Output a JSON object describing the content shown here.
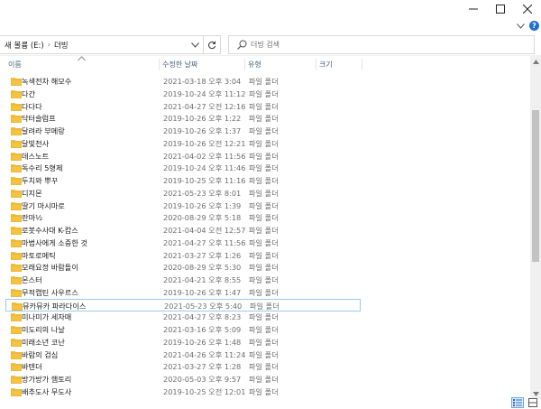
{
  "window": {
    "controls": [
      "minimize-icon",
      "maximize-icon",
      "close-icon"
    ]
  },
  "ribbon": {
    "help_label": "?"
  },
  "address": {
    "crumbs": [
      "새 볼륨 (E:)",
      "더빙"
    ],
    "separator": "›"
  },
  "search": {
    "placeholder": "더빙 검색"
  },
  "columns": {
    "name": "이름",
    "date": "수정한 날짜",
    "type": "유형",
    "size": "크기"
  },
  "colors": {
    "folder": "#f5c342",
    "selection_border": "#99c9ef",
    "accent": "#1f6fd1"
  },
  "files": [
    {
      "name": "녹색전차 해모수",
      "date": "2021-03-18 오후 3:04",
      "type": "파일 폴더"
    },
    {
      "name": "다간",
      "date": "2019-10-24 오후 11:12",
      "type": "파일 폴더"
    },
    {
      "name": "다다다",
      "date": "2021-04-27 오전 12:16",
      "type": "파일 폴더"
    },
    {
      "name": "닥터슬럼프",
      "date": "2019-10-26 오후 1:22",
      "type": "파일 폴더"
    },
    {
      "name": "달려라 부메랑",
      "date": "2019-10-26 오후 1:37",
      "type": "파일 폴더"
    },
    {
      "name": "달빛천사",
      "date": "2019-10-26 오전 12:21",
      "type": "파일 폴더"
    },
    {
      "name": "데스노트",
      "date": "2021-04-02 오후 11:56",
      "type": "파일 폴더"
    },
    {
      "name": "독수리 5형제",
      "date": "2019-10-24 오후 11:46",
      "type": "파일 폴더"
    },
    {
      "name": "두치와 뿌꾸",
      "date": "2019-10-25 오후 11:16",
      "type": "파일 폴더"
    },
    {
      "name": "디지몬",
      "date": "2021-05-23 오후 8:01",
      "type": "파일 폴더"
    },
    {
      "name": "딸기 마시마로",
      "date": "2019-10-26 오후 1:39",
      "type": "파일 폴더"
    },
    {
      "name": "란마½",
      "date": "2020-08-29 오후 5:18",
      "type": "파일 폴더"
    },
    {
      "name": "로봇수사대 K-캅스",
      "date": "2021-04-04 오전 12:57",
      "type": "파일 폴더"
    },
    {
      "name": "마법사에게 소중한 것",
      "date": "2021-04-27 오후 11:56",
      "type": "파일 폴더"
    },
    {
      "name": "마토로메틱",
      "date": "2021-03-27 오후 1:26",
      "type": "파일 폴더"
    },
    {
      "name": "모래요정 바람돌이",
      "date": "2020-08-29 오후 5:30",
      "type": "파일 폴더"
    },
    {
      "name": "몬스터",
      "date": "2021-04-21 오후 8:55",
      "type": "파일 폴더"
    },
    {
      "name": "무적캡틴 사우르스",
      "date": "2019-10-26 오후 1:47",
      "type": "파일 폴더"
    },
    {
      "name": "뮤카뮤카 파라다이스",
      "date": "2021-05-23 오후 5:40",
      "type": "파일 폴더"
    },
    {
      "name": "미나미가 세자매",
      "date": "2021-04-27 오후 8:23",
      "type": "파일 폴더"
    },
    {
      "name": "미도리의 나날",
      "date": "2021-03-16 오후 5:09",
      "type": "파일 폴더"
    },
    {
      "name": "미래소년 코난",
      "date": "2019-10-26 오후 1:48",
      "type": "파일 폴더"
    },
    {
      "name": "바람의 검심",
      "date": "2021-04-26 오후 11:24",
      "type": "파일 폴더"
    },
    {
      "name": "바텐더",
      "date": "2021-03-27 오후 1:28",
      "type": "파일 폴더"
    },
    {
      "name": "방가방가 햄토리",
      "date": "2020-05-03 오후 9:57",
      "type": "파일 폴더"
    },
    {
      "name": "배추도사 무도사",
      "date": "2019-10-25 오전 12:01",
      "type": "파일 폴더"
    }
  ],
  "selected_index": 18
}
